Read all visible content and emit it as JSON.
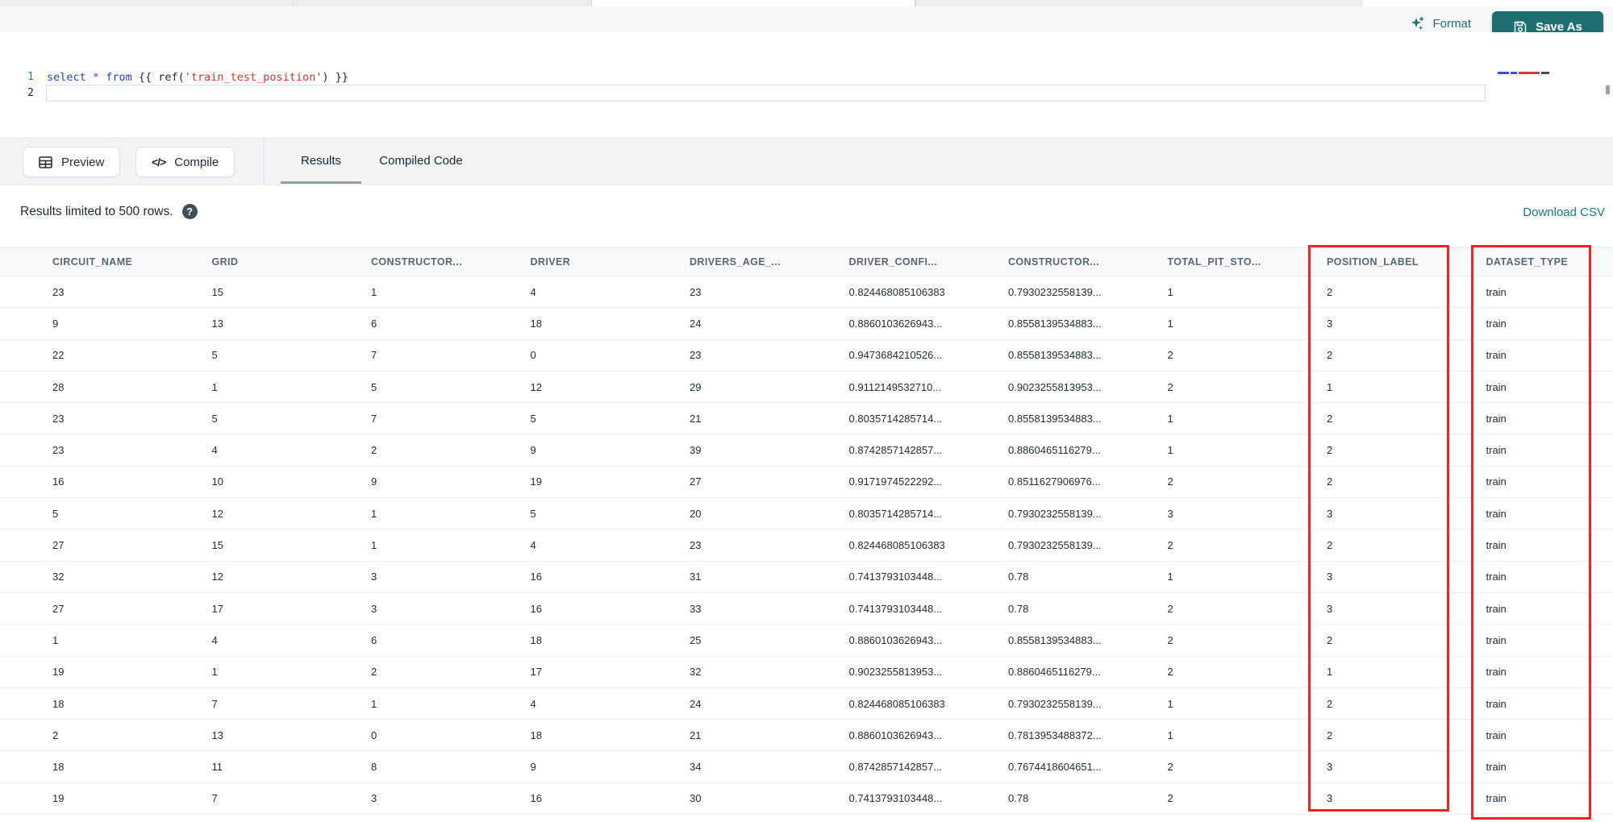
{
  "topbar": {
    "format_label": "Format",
    "save_as_label": "Save As"
  },
  "editor": {
    "line_numbers": [
      "1",
      "2"
    ],
    "code_line": "select * from {{ ref('train_test_position') }}",
    "tokens": [
      {
        "text": "select",
        "type": "keyword"
      },
      {
        "text": " ",
        "type": "plain"
      },
      {
        "text": "*",
        "type": "operator"
      },
      {
        "text": " ",
        "type": "plain"
      },
      {
        "text": "from",
        "type": "keyword"
      },
      {
        "text": " ",
        "type": "plain"
      },
      {
        "text": "{{ ",
        "type": "delimiter"
      },
      {
        "text": "ref(",
        "type": "delimiter"
      },
      {
        "text": "'train_test_position'",
        "type": "string"
      },
      {
        "text": ") ",
        "type": "delimiter"
      },
      {
        "text": "}}",
        "type": "delimiter"
      }
    ]
  },
  "toolbar": {
    "preview_label": "Preview",
    "compile_label": "Compile",
    "compile_glyph": "</>",
    "tabs": [
      {
        "label": "Results",
        "active": true
      },
      {
        "label": "Compiled Code",
        "active": false
      }
    ]
  },
  "results": {
    "limit_text": "Results limited to 500 rows.",
    "help_glyph": "?",
    "download_label": "Download CSV"
  },
  "table": {
    "columns": [
      "CIRCUIT_NAME",
      "GRID",
      "CONSTRUCTOR...",
      "DRIVER",
      "DRIVERS_AGE_...",
      "DRIVER_CONFI...",
      "CONSTRUCTOR...",
      "TOTAL_PIT_STO...",
      "POSITION_LABEL",
      "DATASET_TYPE"
    ],
    "highlighted_columns": [
      "POSITION_LABEL",
      "DATASET_TYPE"
    ],
    "rows": [
      [
        "23",
        "15",
        "1",
        "4",
        "23",
        "0.824468085106383",
        "0.7930232558139...",
        "1",
        "2",
        "train"
      ],
      [
        "9",
        "13",
        "6",
        "18",
        "24",
        "0.8860103626943...",
        "0.8558139534883...",
        "1",
        "3",
        "train"
      ],
      [
        "22",
        "5",
        "7",
        "0",
        "23",
        "0.9473684210526...",
        "0.8558139534883...",
        "2",
        "2",
        "train"
      ],
      [
        "28",
        "1",
        "5",
        "12",
        "29",
        "0.9112149532710...",
        "0.9023255813953...",
        "2",
        "1",
        "train"
      ],
      [
        "23",
        "5",
        "7",
        "5",
        "21",
        "0.8035714285714...",
        "0.8558139534883...",
        "1",
        "2",
        "train"
      ],
      [
        "23",
        "4",
        "2",
        "9",
        "39",
        "0.8742857142857...",
        "0.8860465116279...",
        "1",
        "2",
        "train"
      ],
      [
        "16",
        "10",
        "9",
        "19",
        "27",
        "0.9171974522292...",
        "0.8511627906976...",
        "2",
        "2",
        "train"
      ],
      [
        "5",
        "12",
        "1",
        "5",
        "20",
        "0.8035714285714...",
        "0.7930232558139...",
        "3",
        "3",
        "train"
      ],
      [
        "27",
        "15",
        "1",
        "4",
        "23",
        "0.824468085106383",
        "0.7930232558139...",
        "2",
        "2",
        "train"
      ],
      [
        "32",
        "12",
        "3",
        "16",
        "31",
        "0.7413793103448...",
        "0.78",
        "1",
        "3",
        "train"
      ],
      [
        "27",
        "17",
        "3",
        "16",
        "33",
        "0.7413793103448...",
        "0.78",
        "2",
        "3",
        "train"
      ],
      [
        "1",
        "4",
        "6",
        "18",
        "25",
        "0.8860103626943...",
        "0.8558139534883...",
        "2",
        "2",
        "train"
      ],
      [
        "19",
        "1",
        "2",
        "17",
        "32",
        "0.9023255813953...",
        "0.8860465116279...",
        "2",
        "1",
        "train"
      ],
      [
        "18",
        "7",
        "1",
        "4",
        "24",
        "0.824468085106383",
        "0.7930232558139...",
        "1",
        "2",
        "train"
      ],
      [
        "2",
        "13",
        "0",
        "18",
        "21",
        "0.8860103626943...",
        "0.7813953488372...",
        "1",
        "2",
        "train"
      ],
      [
        "18",
        "11",
        "8",
        "9",
        "34",
        "0.8742857142857...",
        "0.7674418604651...",
        "2",
        "3",
        "train"
      ],
      [
        "19",
        "7",
        "3",
        "16",
        "30",
        "0.7413793103448...",
        "0.78",
        "2",
        "3",
        "train"
      ]
    ]
  },
  "colors": {
    "accent_teal": "#1e6f71",
    "link_teal": "#17768a",
    "annotation_red": "#fb2020"
  }
}
